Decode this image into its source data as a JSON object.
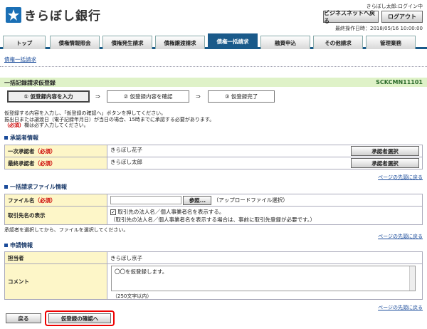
{
  "header": {
    "bank_name": "きらぼし銀行",
    "user_status": "きらぼし太郎:ログイン中",
    "bizsnet_button": "ビジネスネットへ戻る",
    "logout_button": "ログアウト",
    "last_login": "最終操作日時：2018/05/16 10:00:00"
  },
  "tabs": [
    {
      "label": "トップ"
    },
    {
      "label": "債権情報照会"
    },
    {
      "label": "債権発生請求"
    },
    {
      "label": "債権譲渡請求"
    },
    {
      "label": "債権一括請求"
    },
    {
      "label": "融資申込"
    },
    {
      "label": "その他請求"
    },
    {
      "label": "管理業務"
    }
  ],
  "subnav": "債権一括請求",
  "page": {
    "title": "一括記録請求仮登録",
    "screen_code": "SCKCMN11101"
  },
  "steps": {
    "step1": "① 仮登録内容を入力",
    "step2": "② 仮登録内容を確認",
    "step3": "③ 仮登録完了",
    "arrow": "⇒"
  },
  "info": {
    "line1": "仮登録する内容を入力し、「仮登録の確認へ」ボタンを押してください。",
    "line2": "振出日または譲渡日（電子記録年月日）が当日の場合、15時までに承認する必要があります。",
    "req_tag": "（必須）",
    "line3_suffix": "欄は必ず入力してください。"
  },
  "approver": {
    "section_title": "承認者情報",
    "first_label": "一次承認者",
    "first_value": "きらぼし花子",
    "final_label": "最終承認者",
    "final_value": "きらぼし太郎",
    "select_button": "承認者選択",
    "required": "（必須）"
  },
  "page_top": "ページの先頭に戻る",
  "file_info": {
    "section_title": "一括請求ファイル情報",
    "file_label": "ファイル名",
    "required": "（必須）",
    "browse_button": "参照...",
    "browse_note": "（アップロードファイル選択）",
    "display_label": "取引先名の表示",
    "checkbox_label": "取引先の法人名／個人事業者名を表示する。",
    "checkbox_note": "（取引先の法人名／個人事業者名を表示する場合は、事前に取引先登録が必要です。）",
    "note": "承認者を選択してから、ファイルを選択してください。"
  },
  "apply_info": {
    "section_title": "申請情報",
    "person_label": "担当者",
    "person_value": "きらぼし京子",
    "comment_label": "コメント",
    "comment_value": "〇〇を仮登録します。",
    "comment_limit": "（250文字以内）"
  },
  "footer": {
    "back_button": "戻る",
    "confirm_button": "仮登録の確認へ"
  },
  "colors": {
    "tab_active": "#1a5a8a",
    "title_bg": "#dff2c8",
    "label_bg": "#fdf6c8",
    "highlight": "#ee0000"
  }
}
